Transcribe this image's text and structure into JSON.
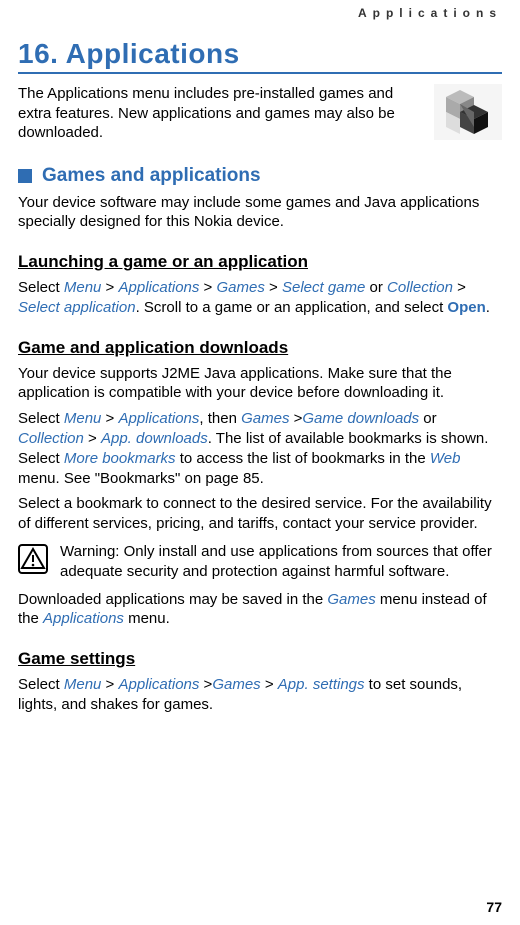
{
  "running_head": "Applications",
  "chapter_title": "16. Applications",
  "intro": "The Applications menu includes pre-installed games and extra features. New applications and games may also be downloaded.",
  "section1_title": "Games and applications",
  "section1_body": "Your device software may include some games and Java applications specially designed for this Nokia device.",
  "sub_launching_title": "Launching a game or an application",
  "launch": {
    "select": "Select ",
    "menu": "Menu",
    "gt1": " > ",
    "applications": "Applications",
    "gt2": " > ",
    "games": "Games",
    "gt3": " > ",
    "select_game": "Select game",
    "or": " or ",
    "collection": "Collection",
    "gt4": " > ",
    "select_app": "Select application",
    "tail": ". Scroll to a game or an application, and select ",
    "open": "Open",
    "dot": "."
  },
  "sub_downloads_title": "Game and application downloads",
  "downloads_p1": "Your device supports J2ME Java applications. Make sure that the application is compatible with your device before downloading it.",
  "dl": {
    "select": "Select ",
    "menu": "Menu",
    "gt1": " > ",
    "applications": "Applications",
    "then": ", then ",
    "games": "Games",
    "gt2": " >",
    "game_downloads": "Game downloads",
    "or": " or ",
    "collection": "Collection",
    "gt3": " > ",
    "app_downloads": "App. downloads",
    "mid": ". The list of available bookmarks is shown. Select ",
    "more_bookmarks": "More bookmarks",
    "mid2": " to access the list of bookmarks in the ",
    "web": "Web",
    "tail": " menu. See \"Bookmarks\" on page 85."
  },
  "downloads_p3": "Select a bookmark to connect to the desired service. For the availability of different services, pricing, and tariffs, contact your service provider.",
  "warning_text": "Warning: Only install and use applications from sources that offer adequate security and protection against harmful software.",
  "saved": {
    "pre": "Downloaded applications may be saved in the ",
    "games": "Games",
    "mid": " menu instead of the ",
    "applications": "Applications",
    "post": " menu."
  },
  "sub_settings_title": "Game settings",
  "settings": {
    "select": "Select ",
    "menu": "Menu",
    "gt1": " > ",
    "applications": "Applications",
    "gt2": " >",
    "games": "Games",
    "gt3": " > ",
    "app_settings": "App. settings",
    "tail": " to set sounds, lights, and shakes for games."
  },
  "page_number": "77"
}
